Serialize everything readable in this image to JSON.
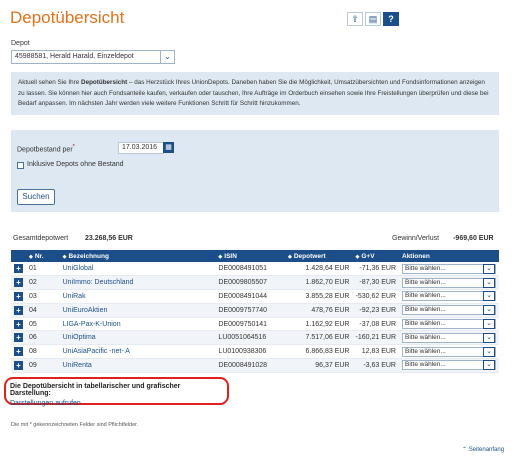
{
  "page": {
    "title": "Depotübersicht"
  },
  "toolbar": {
    "icons": [
      "export-icon",
      "print-icon",
      "help-icon"
    ],
    "help_glyph": "?"
  },
  "depot": {
    "label": "Depot",
    "selected": "45988581, Herald Harald, Einzeldepot"
  },
  "info": {
    "pre": "Aktuell sehen Sie Ihre ",
    "strong": "Depotübersicht",
    "post": " – das Herzstück Ihres UnionDepots. Daneben haben Sie die Möglichkeit, Umsatzübersichten und Fondsinformationen anzeigen zu lassen. Sie können hier auch Fondsanteile kaufen, verkaufen oder tauschen, Ihre Aufträge im Orderbuch einsehen sowie Ihre Freistellungen überprüfen und diese bei Bedarf anpassen. Im nächsten Jahr werden viele weitere Funktionen Schritt für Schritt hinzukommen."
  },
  "filter": {
    "date_label": "Depotbestand per",
    "required_mark": "*",
    "date_value": "17.03.2016",
    "checkbox_label": "Inklusive Depots ohne Bestand",
    "search_button": "Suchen"
  },
  "summary": {
    "total_label": "Gesamtdepotwert",
    "total_value": "23.268,56 EUR",
    "gain_label": "Gewinn/Verlust",
    "gain_value": "-969,60 EUR"
  },
  "table": {
    "headers": [
      "Nr.",
      "Bezeichnung",
      "ISIN",
      "Depotwert",
      "G+V",
      "Aktionen"
    ],
    "action_placeholder": "Bitte wählen...",
    "rows": [
      {
        "nr": "01",
        "name": "UniGlobal",
        "isin": "DE0008491051",
        "value": "1.428,64 EUR",
        "gv": "-71,36 EUR"
      },
      {
        "nr": "02",
        "name": "UniImmo: Deutschland",
        "isin": "DE0009805507",
        "value": "1.862,70 EUR",
        "gv": "-87,30 EUR"
      },
      {
        "nr": "03",
        "name": "UniRak",
        "isin": "DE0008491044",
        "value": "3.855,28 EUR",
        "gv": "-530,62 EUR"
      },
      {
        "nr": "04",
        "name": "UniEuroAktien",
        "isin": "DE0009757740",
        "value": "478,76 EUR",
        "gv": "-92,23 EUR"
      },
      {
        "nr": "05",
        "name": "LIGA-Pax-K-Union",
        "isin": "DE0009750141",
        "value": "1.162,92 EUR",
        "gv": "-37,08 EUR"
      },
      {
        "nr": "06",
        "name": "UniOptima",
        "isin": "LU0051064516",
        "value": "7.517,06 EUR",
        "gv": "-160,21 EUR"
      },
      {
        "nr": "08",
        "name": "UniAsiaPacific -net- A",
        "isin": "LU0100938306",
        "value": "6.866,83 EUR",
        "gv": "12,83 EUR"
      },
      {
        "nr": "09",
        "name": "UniRenta",
        "isin": "DE0008491028",
        "value": "96,37 EUR",
        "gv": "-3,63 EUR"
      }
    ]
  },
  "callout": {
    "title": "Die Depotübersicht in tabellarischer und grafischer Darstellung:",
    "link": "Darstellungen aufrufen"
  },
  "footnote": "Die mit * gekennzeichneten Felder sind Pflichtfelder.",
  "back_to_top": "Seitenanfang"
}
